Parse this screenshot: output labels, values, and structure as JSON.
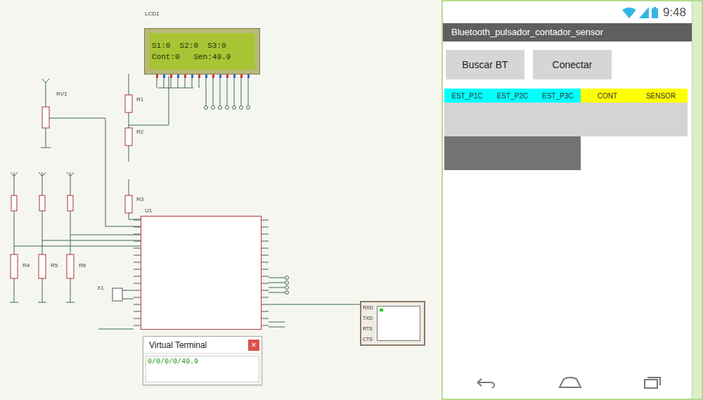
{
  "simulator": {
    "lcd": {
      "label": "LCD1",
      "lines": [
        "S1:0  S2:0  S3:0",
        "Cont:0   Sen:49.9"
      ]
    },
    "components": [
      {
        "label": "RV1"
      },
      {
        "label": "R1"
      },
      {
        "label": "R2"
      },
      {
        "label": "R3"
      },
      {
        "label": "R4"
      },
      {
        "label": "R5"
      },
      {
        "label": "R6"
      },
      {
        "label": "X1"
      },
      {
        "label": "U1"
      }
    ],
    "terminal_pins": [
      "RXD",
      "TXD",
      "RTS",
      "CTS"
    ],
    "virtual_terminal": {
      "title": "Virtual Terminal",
      "close": "×",
      "output": "0/0/0/0/49.9"
    }
  },
  "phone": {
    "status_bar": {
      "time": "9:48"
    },
    "app_title": "Bluetooth_pulsador_contador_sensor",
    "buttons": [
      "Buscar BT",
      "Conectar"
    ],
    "table": {
      "headers": [
        {
          "label": "EST_P1C",
          "color": "#00ffff"
        },
        {
          "label": "EST_P2C",
          "color": "#00ffff"
        },
        {
          "label": "EST_P3C",
          "color": "#00ffff"
        },
        {
          "label": "CONT",
          "color": "#ffff00"
        },
        {
          "label": "SENSOR",
          "color": "#ffff00"
        }
      ]
    }
  }
}
